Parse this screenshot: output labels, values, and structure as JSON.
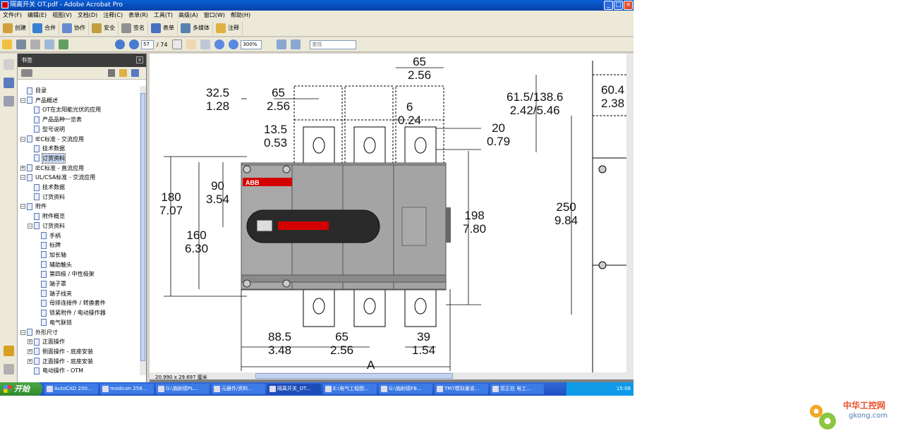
{
  "window": {
    "title": "隔离开关 OT.pdf - Adobe Acrobat Pro",
    "controls": {
      "minimize": "_",
      "maximize": "□",
      "close": "×"
    }
  },
  "menu": [
    "文件(F)",
    "编辑(E)",
    "视图(V)",
    "文档(D)",
    "注释(C)",
    "表单(R)",
    "工具(T)",
    "高级(A)",
    "窗口(W)",
    "帮助(H)"
  ],
  "toolbar": [
    "创建",
    "合并",
    "协作",
    "安全",
    "签名",
    "表单",
    "多媒体",
    "注释"
  ],
  "navigation": {
    "current_page": "57",
    "page_count": "/ 74",
    "zoom": "300%",
    "search_placeholder": "查找"
  },
  "bookmarks": {
    "header": "书签",
    "close": "×",
    "items": [
      {
        "label": "目录",
        "level": 0,
        "expander": ""
      },
      {
        "label": "产品概述",
        "level": 0,
        "expander": "−"
      },
      {
        "label": "OT在太阳能光伏的应用",
        "level": 1,
        "expander": ""
      },
      {
        "label": "产品品种一览表",
        "level": 1,
        "expander": ""
      },
      {
        "label": "型号说明",
        "level": 1,
        "expander": ""
      },
      {
        "label": "IEC标准 - 交流应用",
        "level": 0,
        "expander": "−"
      },
      {
        "label": "技术数据",
        "level": 1,
        "expander": ""
      },
      {
        "label": "订货资料",
        "level": 1,
        "expander": "",
        "selected": true
      },
      {
        "label": "IEC标准 - 直流应用",
        "level": 0,
        "expander": "+"
      },
      {
        "label": "UL/CSA标准 - 交流应用",
        "level": 0,
        "expander": "−"
      },
      {
        "label": "技术数据",
        "level": 1,
        "expander": ""
      },
      {
        "label": "订货资料",
        "level": 1,
        "expander": ""
      },
      {
        "label": "附件",
        "level": 0,
        "expander": "−"
      },
      {
        "label": "附件概览",
        "level": 1,
        "expander": ""
      },
      {
        "label": "订货资料",
        "level": 1,
        "expander": "−"
      },
      {
        "label": "手柄",
        "level": 2,
        "expander": ""
      },
      {
        "label": "标牌",
        "level": 2,
        "expander": ""
      },
      {
        "label": "加长轴",
        "level": 2,
        "expander": ""
      },
      {
        "label": "辅助触头",
        "level": 2,
        "expander": ""
      },
      {
        "label": "第四极 / 中性极架",
        "level": 2,
        "expander": ""
      },
      {
        "label": "端子罩",
        "level": 2,
        "expander": ""
      },
      {
        "label": "端子线夹",
        "level": 2,
        "expander": ""
      },
      {
        "label": "母排连接件 / 转换套件",
        "level": 2,
        "expander": ""
      },
      {
        "label": "锁紧附件 / 电动操作器",
        "level": 2,
        "expander": ""
      },
      {
        "label": "电气联锁",
        "level": 2,
        "expander": ""
      },
      {
        "label": "外形尺寸",
        "level": 0,
        "expander": "−"
      },
      {
        "label": "正面操作",
        "level": 1,
        "expander": "+"
      },
      {
        "label": "侧面操作 - 底座安装",
        "level": 1,
        "expander": "+"
      },
      {
        "label": "正面操作 - 底座安装",
        "level": 1,
        "expander": "+"
      },
      {
        "label": "电动操作 - OTM",
        "level": 1,
        "expander": ""
      }
    ]
  },
  "drawing": {
    "brand": "ABB",
    "dims": {
      "d1": "32.5",
      "d1b": "1.28",
      "d2": "65",
      "d2b": "2.56",
      "d3": "65",
      "d3b": "2.56",
      "d4": "6",
      "d4b": "0.24",
      "d5": "13.5",
      "d5b": "0.53",
      "d6": "20",
      "d6b": "0.79",
      "d7": "61.5/138.6",
      "d7b": "2.42/5.46",
      "d8": "60.4",
      "d8b": "2.38",
      "d9": "180",
      "d9b": "7.07",
      "d10": "90",
      "d10b": "3.54",
      "d11": "160",
      "d11b": "6.30",
      "d12": "198",
      "d12b": "7.80",
      "d13": "250",
      "d13b": "9.84",
      "d14": "88.5",
      "d14b": "3.48",
      "d15": "65",
      "d15b": "2.56",
      "d16": "39",
      "d16b": "1.54",
      "d17": "A"
    }
  },
  "page_size": "20.990 x 29.697 厘米",
  "taskbar": {
    "start": "开始",
    "tasks": [
      "AutoCAD 200...",
      "modicon 258...",
      "G:\\施耐德PL...",
      "元器件/资料...",
      "隔离开关_OT...",
      "E:\\电气工程图...",
      "G:\\施耐德FB...",
      "TM7模拟量说...",
      "您正在 电工..."
    ],
    "clock": "15:08"
  },
  "watermark": {
    "cn": "中华工控网",
    "en": "gkong.com"
  },
  "colors": {
    "titlebar": "#0a5fd6",
    "brand_red": "#d40000",
    "switch_body": "#9a9a9a"
  }
}
